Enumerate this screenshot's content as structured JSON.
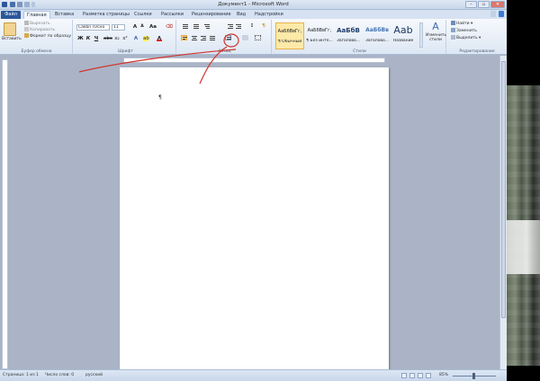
{
  "window": {
    "title": "Документ1 - Microsoft Word"
  },
  "tabs": [
    "Файл",
    "Главная",
    "Вставка",
    "Разметка страницы",
    "Ссылки",
    "Рассылки",
    "Рецензирование",
    "Вид",
    "Надстройки"
  ],
  "clipboard": {
    "paste": "Вставить",
    "cut": "Вырезать",
    "copy": "Копировать",
    "format_painter": "Формат по образцу",
    "label": "Буфер обмена"
  },
  "font": {
    "name": "Calibri (Осно",
    "size": "11",
    "label": "Шрифт"
  },
  "paragraph": {
    "label": "Абзац"
  },
  "styles": {
    "label": "Стили",
    "items": [
      {
        "sample": "АаБбВвГг,",
        "name": "¶ Обычный",
        "color": "#222",
        "size": "5px"
      },
      {
        "sample": "АаБбВвГг,",
        "name": "¶ Без инте...",
        "color": "#222",
        "size": "5px"
      },
      {
        "sample": "АаБбВ",
        "name": "Заголово...",
        "color": "#1f3d6b",
        "size": "7px"
      },
      {
        "sample": "АаБбВв",
        "name": "Заголово...",
        "color": "#4575b4",
        "size": "6px"
      },
      {
        "sample": "Aab",
        "name": "Название",
        "color": "#17365d",
        "size": "11px"
      }
    ],
    "change": "Изменить стили"
  },
  "editing": {
    "find": "Найти",
    "replace": "Заменить",
    "select": "Выделить",
    "label": "Редактирование"
  },
  "status": {
    "page": "Страница: 1 из 1",
    "words": "Число слов: 0",
    "lang": "русский",
    "zoom": "85%"
  },
  "colors": {
    "accent": "#2b579a",
    "annotation": "#d0342c"
  }
}
